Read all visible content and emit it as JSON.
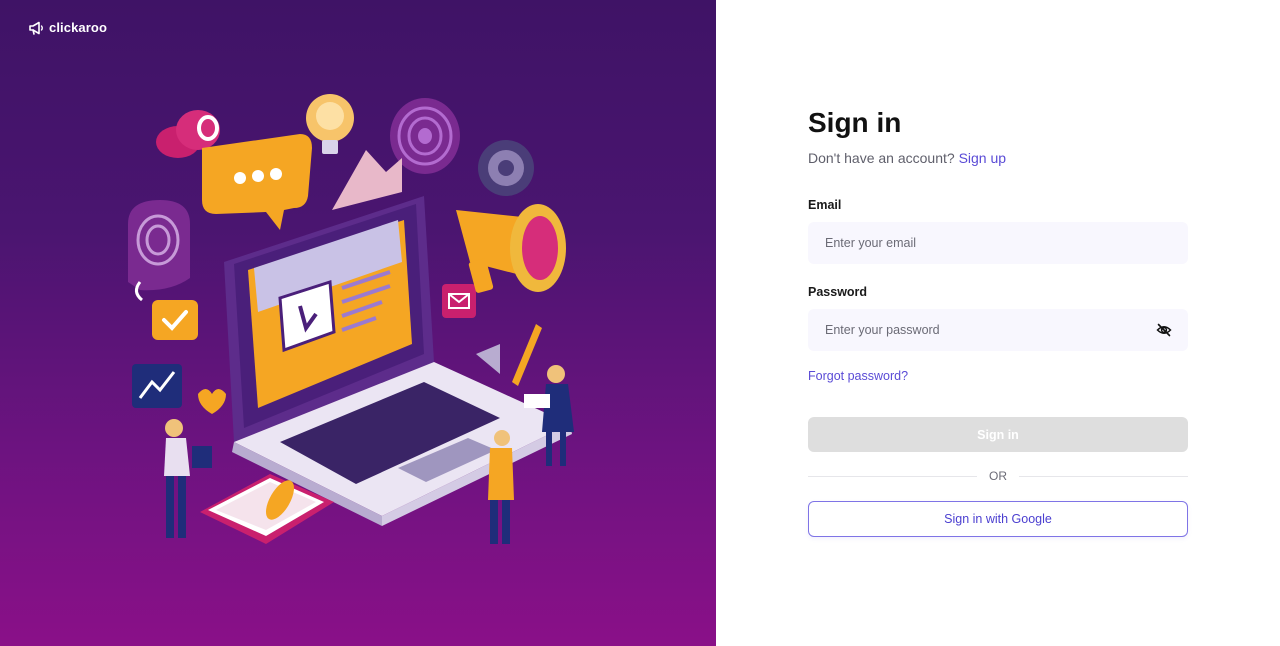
{
  "brand": {
    "name": "clickaroo",
    "icon": "megaphone-icon"
  },
  "signin": {
    "title": "Sign in",
    "no_account_text": "Don't have an account?",
    "signup_link": "Sign up",
    "email_label": "Email",
    "email_placeholder": "Enter your email",
    "email_value": "",
    "password_label": "Password",
    "password_placeholder": "Enter your password",
    "password_value": "",
    "password_toggle_icon": "eye-off-icon",
    "forgot_link": "Forgot password?",
    "signin_button": "Sign in",
    "divider_text": "OR",
    "google_button": "Sign in with Google"
  },
  "colors": {
    "left_panel_top": "#3f1366",
    "left_panel_bottom": "#8a1088",
    "accent": "#5a4bd6",
    "disabled_button": "#dedede"
  }
}
